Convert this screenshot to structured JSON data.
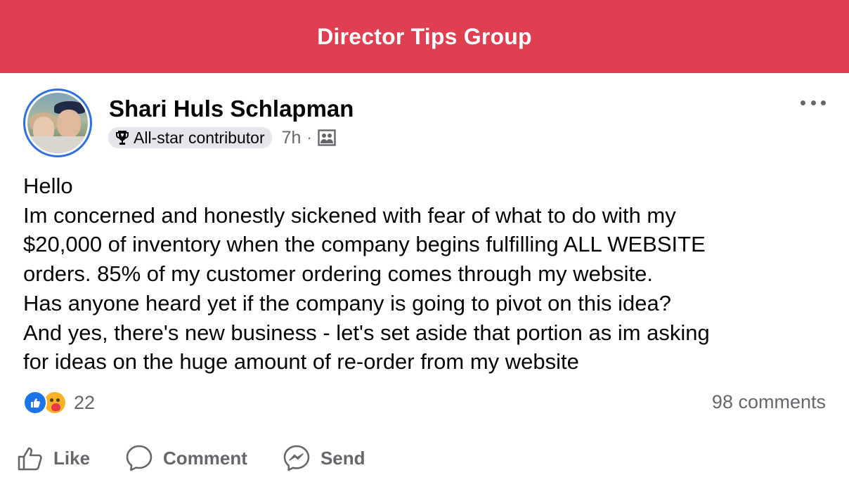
{
  "header": {
    "title": "Director Tips Group"
  },
  "post": {
    "author": "Shari Huls Schlapman",
    "badge": "All-star contributor",
    "time": "7h",
    "separator": "·",
    "privacy_icon": "group-icon",
    "lines": [
      "Hello",
      "Im concerned and honestly sickened with fear of what to do with my",
      "$20,000 of inventory when the company begins fulfilling ALL WEBSITE",
      "orders. 85% of my customer ordering comes through my website.",
      "Has anyone heard yet if the company is going to pivot on this idea?",
      "And yes, there's new business - let's set aside that portion as im asking",
      "for ideas on the huge amount of re-order from my website"
    ],
    "reactions": {
      "types": [
        "like",
        "care"
      ],
      "count": "22"
    },
    "comments": "98 comments"
  },
  "actions": {
    "like": "Like",
    "comment": "Comment",
    "send": "Send"
  },
  "colors": {
    "header_bg": "#df3f51",
    "accent": "#2f6fe0",
    "secondary_text": "#65676b"
  }
}
